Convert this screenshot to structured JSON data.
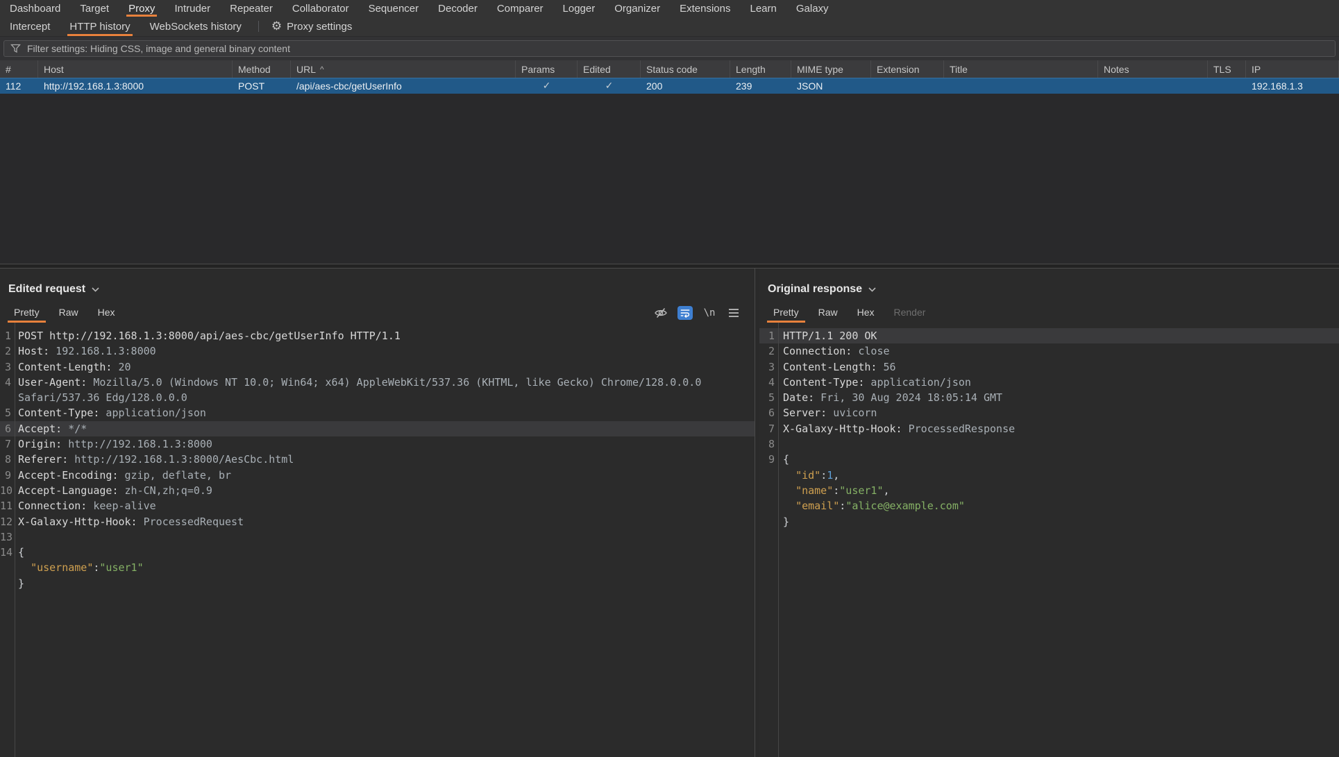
{
  "colors": {
    "accent_orange": "#e8813c",
    "selection_blue": "#215988",
    "wrap_button_blue": "#3e7fd1",
    "editor_background": "#2b2b2b",
    "json_key": "#cfa050",
    "json_string": "#85b165",
    "json_number": "#5f9fd6"
  },
  "menubar": {
    "items": [
      {
        "label": "Dashboard",
        "active": false
      },
      {
        "label": "Target",
        "active": false
      },
      {
        "label": "Proxy",
        "active": true
      },
      {
        "label": "Intruder",
        "active": false
      },
      {
        "label": "Repeater",
        "active": false
      },
      {
        "label": "Collaborator",
        "active": false
      },
      {
        "label": "Sequencer",
        "active": false
      },
      {
        "label": "Decoder",
        "active": false
      },
      {
        "label": "Comparer",
        "active": false
      },
      {
        "label": "Logger",
        "active": false
      },
      {
        "label": "Organizer",
        "active": false
      },
      {
        "label": "Extensions",
        "active": false
      },
      {
        "label": "Learn",
        "active": false
      },
      {
        "label": "Galaxy",
        "active": false
      }
    ]
  },
  "subtabs": {
    "items": [
      {
        "label": "Intercept",
        "active": false
      },
      {
        "label": "HTTP history",
        "active": true
      },
      {
        "label": "WebSockets history",
        "active": false
      }
    ],
    "settings_label": "Proxy settings",
    "settings_icon": "gear-icon"
  },
  "filter_bar": {
    "icon": "funnel-icon",
    "text": "Filter settings: Hiding CSS, image and general binary content"
  },
  "history_table": {
    "columns": [
      {
        "label": "#"
      },
      {
        "label": "Host"
      },
      {
        "label": "Method"
      },
      {
        "label": "URL",
        "sort_indicator": "^"
      },
      {
        "label": "Params"
      },
      {
        "label": "Edited"
      },
      {
        "label": "Status code"
      },
      {
        "label": "Length"
      },
      {
        "label": "MIME type"
      },
      {
        "label": "Extension"
      },
      {
        "label": "Title"
      },
      {
        "label": "Notes"
      },
      {
        "label": "TLS"
      },
      {
        "label": "IP"
      }
    ],
    "row": {
      "cells": [
        "112",
        "http://192.168.1.3:8000",
        "POST",
        "/api/aes-cbc/getUserInfo",
        "✓",
        "✓",
        "200",
        "239",
        "JSON",
        "",
        "",
        "",
        "",
        "192.168.1.3"
      ],
      "selected": true
    }
  },
  "request_panel": {
    "title": "Edited request",
    "tabs": [
      {
        "label": "Pretty",
        "active": true
      },
      {
        "label": "Raw",
        "active": false
      },
      {
        "label": "Hex",
        "active": false
      }
    ],
    "toolbar_icons": [
      {
        "name": "hide-eye-icon",
        "glyph": "eye-off",
        "active": false
      },
      {
        "name": "word-wrap-icon",
        "glyph": "wrap",
        "active": true
      },
      {
        "name": "newline-toggle-icon",
        "glyph": "\\n",
        "active": false
      },
      {
        "name": "editor-menu-icon",
        "glyph": "hamburger",
        "active": false
      }
    ],
    "lines": [
      {
        "n": "1",
        "parts": [
          {
            "c": "name",
            "t": "POST http://192.168.1.3:8000/api/aes-cbc/getUserInfo HTTP/1.1"
          }
        ]
      },
      {
        "n": "2",
        "parts": [
          {
            "c": "name",
            "t": "Host:"
          },
          {
            "c": "val",
            "t": " 192.168.1.3:8000"
          }
        ]
      },
      {
        "n": "3",
        "parts": [
          {
            "c": "name",
            "t": "Content-Length:"
          },
          {
            "c": "val",
            "t": " 20"
          }
        ]
      },
      {
        "n": "4",
        "parts": [
          {
            "c": "name",
            "t": "User-Agent:"
          },
          {
            "c": "val",
            "t": " Mozilla/5.0 (Windows NT 10.0; Win64; x64) AppleWebKit/537.36 (KHTML, like Gecko) Chrome/128.0.0.0"
          }
        ]
      },
      {
        "n": "",
        "parts": [
          {
            "c": "val",
            "t": "Safari/537.36 Edg/128.0.0.0"
          }
        ]
      },
      {
        "n": "5",
        "parts": [
          {
            "c": "name",
            "t": "Content-Type:"
          },
          {
            "c": "val",
            "t": " application/json"
          }
        ]
      },
      {
        "n": "6",
        "hl": true,
        "parts": [
          {
            "c": "name",
            "t": "Accept:"
          },
          {
            "c": "val",
            "t": " */*"
          }
        ]
      },
      {
        "n": "7",
        "parts": [
          {
            "c": "name",
            "t": "Origin:"
          },
          {
            "c": "val",
            "t": " http://192.168.1.3:8000"
          }
        ]
      },
      {
        "n": "8",
        "parts": [
          {
            "c": "name",
            "t": "Referer:"
          },
          {
            "c": "val",
            "t": " http://192.168.1.3:8000/AesCbc.html"
          }
        ]
      },
      {
        "n": "9",
        "parts": [
          {
            "c": "name",
            "t": "Accept-Encoding:"
          },
          {
            "c": "val",
            "t": " gzip, deflate, br"
          }
        ]
      },
      {
        "n": "10",
        "parts": [
          {
            "c": "name",
            "t": "Accept-Language:"
          },
          {
            "c": "val",
            "t": " zh-CN,zh;q=0.9"
          }
        ]
      },
      {
        "n": "11",
        "parts": [
          {
            "c": "name",
            "t": "Connection:"
          },
          {
            "c": "val",
            "t": " keep-alive"
          }
        ]
      },
      {
        "n": "12",
        "parts": [
          {
            "c": "name",
            "t": "X-Galaxy-Http-Hook:"
          },
          {
            "c": "val",
            "t": " ProcessedRequest"
          }
        ]
      },
      {
        "n": "13",
        "parts": []
      },
      {
        "n": "14",
        "parts": [
          {
            "c": "plain",
            "t": "{"
          }
        ]
      },
      {
        "n": "",
        "parts": [
          {
            "c": "plain",
            "t": "  "
          },
          {
            "c": "key",
            "t": "\"username\""
          },
          {
            "c": "plain",
            "t": ":"
          },
          {
            "c": "str",
            "t": "\"user1\""
          }
        ]
      },
      {
        "n": "",
        "parts": [
          {
            "c": "plain",
            "t": "}"
          }
        ]
      }
    ]
  },
  "response_panel": {
    "title": "Original response",
    "tabs": [
      {
        "label": "Pretty",
        "active": true
      },
      {
        "label": "Raw",
        "active": false
      },
      {
        "label": "Hex",
        "active": false
      },
      {
        "label": "Render",
        "active": false,
        "disabled": true
      }
    ],
    "toolbar_icons": [],
    "lines": [
      {
        "n": "1",
        "hl": true,
        "parts": [
          {
            "c": "name",
            "t": "HTTP/1.1 200 OK"
          }
        ]
      },
      {
        "n": "2",
        "parts": [
          {
            "c": "name",
            "t": "Connection:"
          },
          {
            "c": "val",
            "t": " close"
          }
        ]
      },
      {
        "n": "3",
        "parts": [
          {
            "c": "name",
            "t": "Content-Length:"
          },
          {
            "c": "val",
            "t": " 56"
          }
        ]
      },
      {
        "n": "4",
        "parts": [
          {
            "c": "name",
            "t": "Content-Type:"
          },
          {
            "c": "val",
            "t": " application/json"
          }
        ]
      },
      {
        "n": "5",
        "parts": [
          {
            "c": "name",
            "t": "Date:"
          },
          {
            "c": "val",
            "t": " Fri, 30 Aug 2024 18:05:14 GMT"
          }
        ]
      },
      {
        "n": "6",
        "parts": [
          {
            "c": "name",
            "t": "Server:"
          },
          {
            "c": "val",
            "t": " uvicorn"
          }
        ]
      },
      {
        "n": "7",
        "parts": [
          {
            "c": "name",
            "t": "X-Galaxy-Http-Hook:"
          },
          {
            "c": "val",
            "t": " ProcessedResponse"
          }
        ]
      },
      {
        "n": "8",
        "parts": []
      },
      {
        "n": "9",
        "parts": [
          {
            "c": "plain",
            "t": "{"
          }
        ]
      },
      {
        "n": "",
        "parts": [
          {
            "c": "plain",
            "t": "  "
          },
          {
            "c": "key",
            "t": "\"id\""
          },
          {
            "c": "plain",
            "t": ":"
          },
          {
            "c": "num",
            "t": "1"
          },
          {
            "c": "plain",
            "t": ","
          }
        ]
      },
      {
        "n": "",
        "parts": [
          {
            "c": "plain",
            "t": "  "
          },
          {
            "c": "key",
            "t": "\"name\""
          },
          {
            "c": "plain",
            "t": ":"
          },
          {
            "c": "str",
            "t": "\"user1\""
          },
          {
            "c": "plain",
            "t": ","
          }
        ]
      },
      {
        "n": "",
        "parts": [
          {
            "c": "plain",
            "t": "  "
          },
          {
            "c": "key",
            "t": "\"email\""
          },
          {
            "c": "plain",
            "t": ":"
          },
          {
            "c": "str",
            "t": "\"alice@example.com\""
          }
        ]
      },
      {
        "n": "",
        "parts": [
          {
            "c": "plain",
            "t": "}"
          }
        ]
      }
    ]
  }
}
